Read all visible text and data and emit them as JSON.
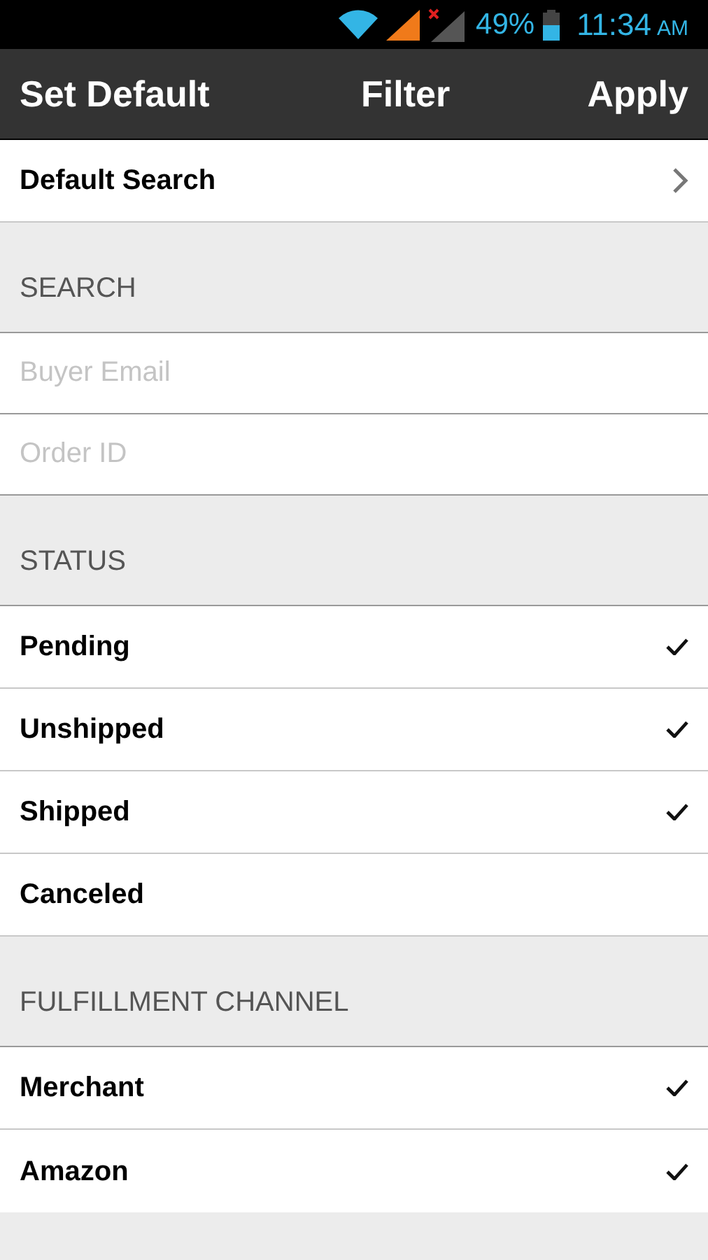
{
  "status_bar": {
    "battery": "49%",
    "time": "11:34",
    "meridiem": "AM"
  },
  "toolbar": {
    "left_button": "Set Default",
    "title": "Filter",
    "right_button": "Apply"
  },
  "default_search": {
    "label": "Default Search"
  },
  "sections": [
    {
      "header": "SEARCH",
      "kind": "fields",
      "fields": [
        {
          "placeholder": "Buyer Email"
        },
        {
          "placeholder": "Order ID"
        }
      ]
    },
    {
      "header": "STATUS",
      "kind": "options",
      "options": [
        {
          "label": "Pending",
          "checked": true
        },
        {
          "label": "Unshipped",
          "checked": true
        },
        {
          "label": "Shipped",
          "checked": true
        },
        {
          "label": "Canceled",
          "checked": false
        }
      ]
    },
    {
      "header": "FULFILLMENT CHANNEL",
      "kind": "options",
      "options": [
        {
          "label": "Merchant",
          "checked": true
        },
        {
          "label": "Amazon",
          "checked": true
        }
      ]
    }
  ]
}
